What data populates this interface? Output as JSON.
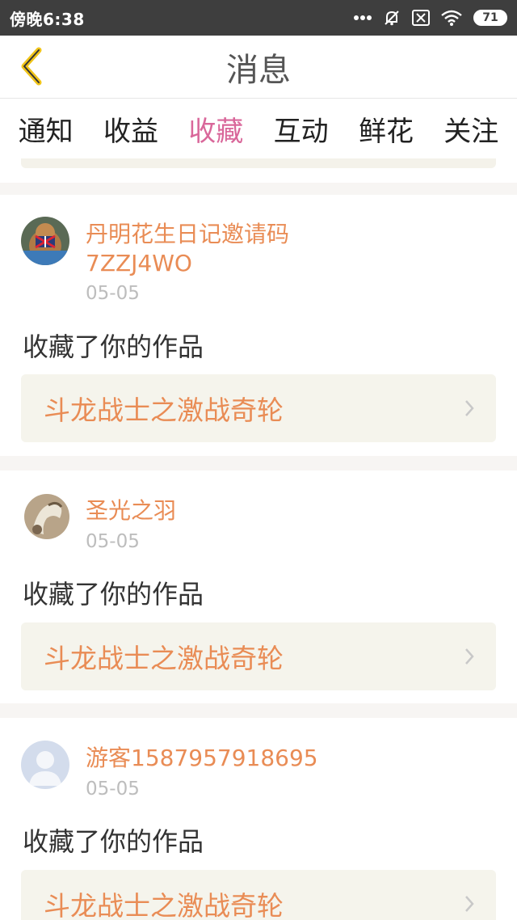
{
  "status_bar": {
    "time": "傍晚6:38",
    "battery": "71",
    "icons": [
      "more-dots-icon",
      "mute-bell-icon",
      "no-sim-icon",
      "wifi-icon",
      "battery-icon"
    ]
  },
  "header": {
    "title": "消息",
    "back_icon": "chevron-left-icon"
  },
  "tabs": [
    {
      "label": "通知",
      "active": false
    },
    {
      "label": "收益",
      "active": false
    },
    {
      "label": "收藏",
      "active": true
    },
    {
      "label": "互动",
      "active": false
    },
    {
      "label": "鲜花",
      "active": false
    },
    {
      "label": "关注",
      "active": false
    }
  ],
  "colors": {
    "accent": "#d9679a",
    "name": "#e98c55",
    "date": "#bdbdbd"
  },
  "messages": [
    {
      "user": "丹明花生日记邀请码7ZZJ4WO",
      "date": "05-05",
      "action": "收藏了你的作品",
      "work": "斗龙战士之激战奇轮"
    },
    {
      "user": "圣光之羽",
      "date": "05-05",
      "action": "收藏了你的作品",
      "work": "斗龙战士之激战奇轮"
    },
    {
      "user": "游客1587957918695",
      "date": "05-05",
      "action": "收藏了你的作品",
      "work": "斗龙战士之激战奇轮"
    }
  ]
}
